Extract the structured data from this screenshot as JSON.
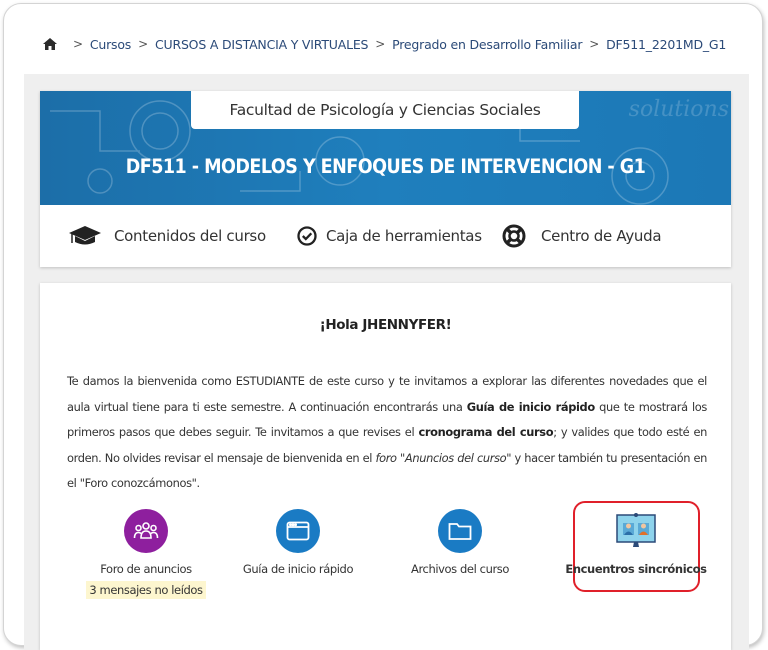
{
  "breadcrumb": {
    "items": [
      {
        "label": "Cursos"
      },
      {
        "label": "CURSOS A DISTANCIA Y VIRTUALES"
      },
      {
        "label": "Pregrado en Desarrollo Familiar"
      },
      {
        "label": "DF511_2201MD_G1"
      }
    ],
    "separator": ">"
  },
  "header": {
    "faculty": "Facultad de Psicología y Ciencias Sociales",
    "course_title": "DF511 - MODELOS Y ENFOQUES DE INTERVENCION - G1",
    "banner_watermark": "solutions",
    "accent_color": "#1f7fbd"
  },
  "nav": {
    "items": [
      {
        "label": "Contenidos del curso",
        "icon": "graduation-cap-icon"
      },
      {
        "label": "Caja de herramientas",
        "icon": "check-circle-icon"
      },
      {
        "label": "Centro de Ayuda",
        "icon": "life-ring-icon"
      }
    ]
  },
  "welcome": {
    "greeting": "¡Hola JHENNYFER!",
    "p1": "Te damos la bienvenida como ESTUDIANTE de este curso y te invitamos a explorar las diferentes novedades que el aula virtual tiene para ti este semestre. A continuación encontrarás una ",
    "p1_bold": "Guía de inicio rápido",
    "p2": " que te mostrará los primeros pasos que debes seguir.  Te invitamos a que revises el ",
    "p2_bold": "cronograma del curso",
    "p3": "; y valides que todo esté en orden. No olvides revisar el mensaje de bienvenida en el ",
    "p3_italic": "foro \"Anuncios del curso\"",
    "p4": " y hacer también tu presentación en el \"Foro conozcámonos\"."
  },
  "tiles": [
    {
      "label": "Foro de anuncios",
      "icon": "users-group-icon",
      "color": "#8e1f9e",
      "badge": "3 mensajes no leídos"
    },
    {
      "label": "Guía de inicio rápido",
      "icon": "browser-window-icon",
      "color": "#1a7bc4"
    },
    {
      "label": "Archivos del curso",
      "icon": "folder-icon",
      "color": "#1a7bc4"
    },
    {
      "label": "Encuentros sincrónicos",
      "icon": "video-meeting-icon",
      "highlight_color": "#e0202a"
    }
  ]
}
